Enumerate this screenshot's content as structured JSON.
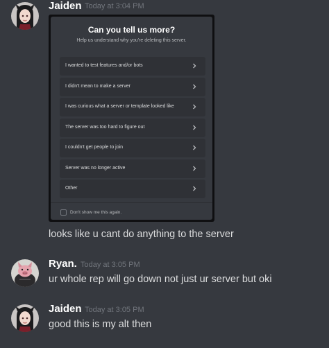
{
  "messages": [
    {
      "author": "Jaiden",
      "timestamp": "Today at 3:04 PM",
      "text": "looks like u cant do anything to the server",
      "avatar": "girl-avatar"
    },
    {
      "author": "Ryan.",
      "timestamp": "Today at 3:05 PM",
      "text": "ur whole rep will go down not just ur server but oki",
      "avatar": "pig-avatar"
    },
    {
      "author": "Jaiden",
      "timestamp": "Today at 3:05 PM",
      "text": "good this is my alt then",
      "avatar": "girl-avatar"
    }
  ],
  "modal": {
    "title": "Can you tell us more?",
    "subtitle": "Help us understand why you're deleting this server.",
    "options": [
      "I wanted to test features and/or bots",
      "I didn't mean to make a server",
      "I was curious what a server or template looked like",
      "The server was too hard to figure out",
      "I couldn't get people to join",
      "Server was no longer active",
      "Other"
    ],
    "checkbox_label": "Don't show me this again."
  },
  "colors": {
    "background": "#36393f",
    "option_bg": "#2f3136",
    "author": "#ffffff",
    "timestamp": "#72767d",
    "text": "#dcddde"
  }
}
